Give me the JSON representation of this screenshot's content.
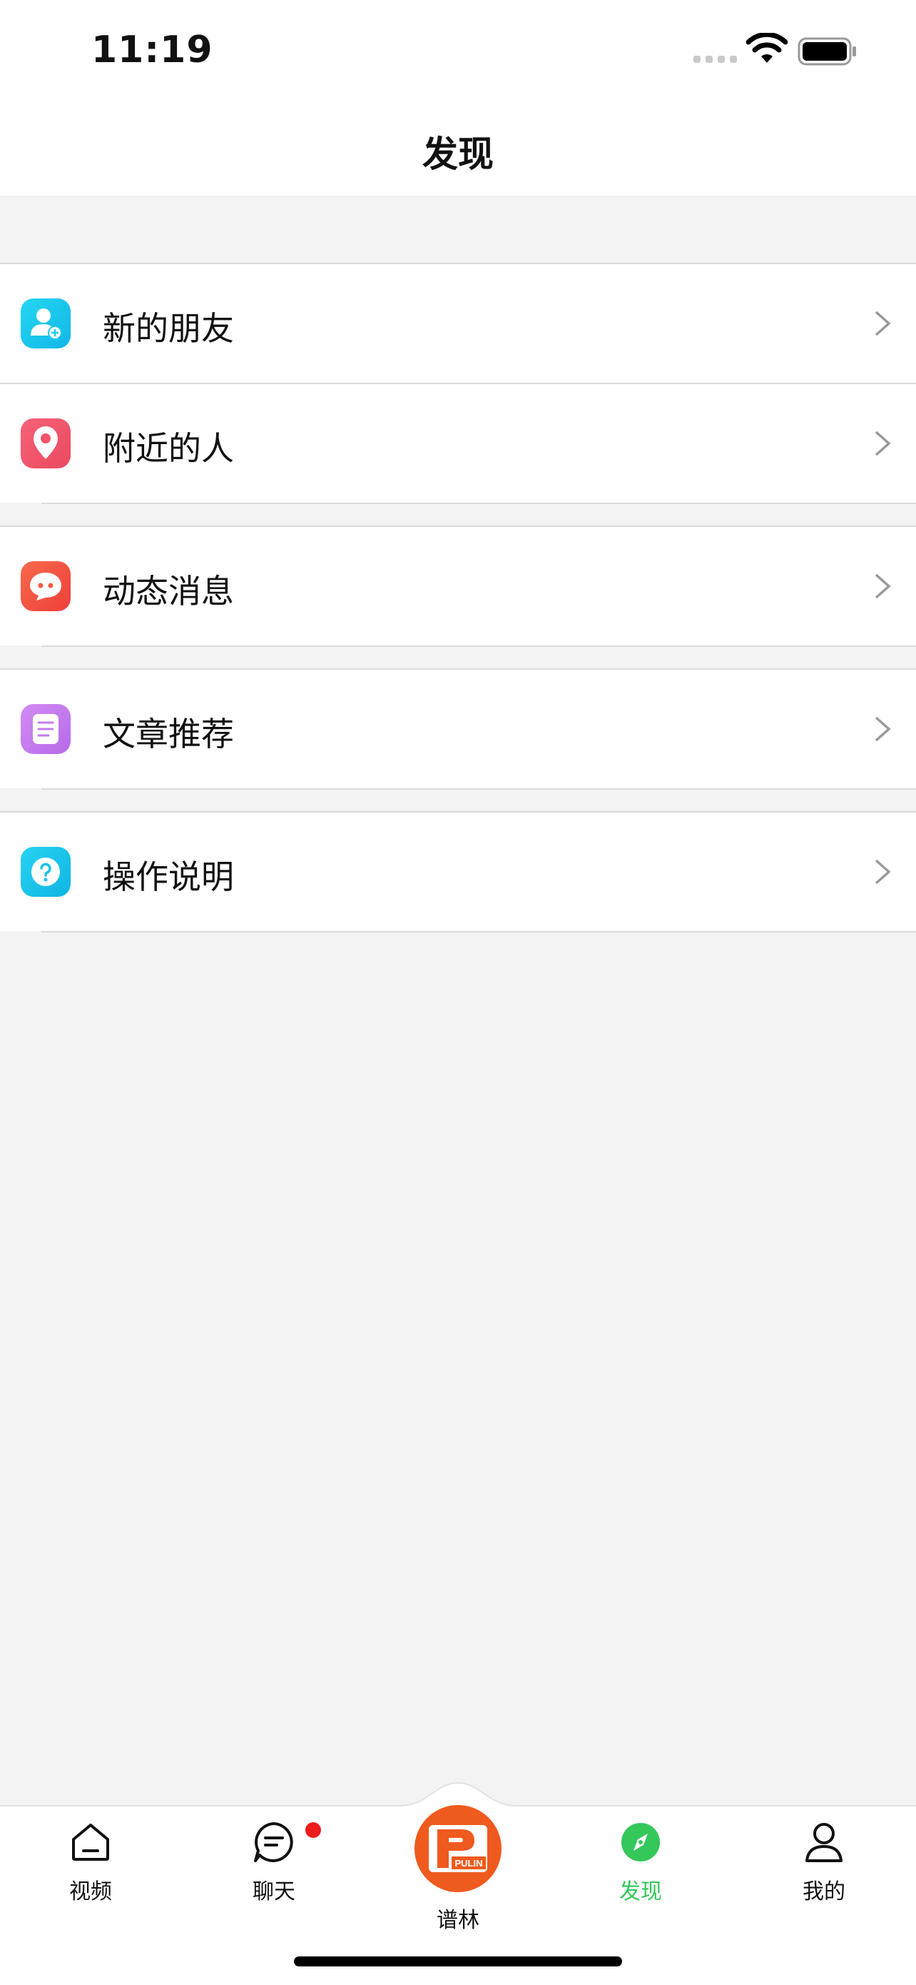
{
  "status_bar": {
    "time": "11:19"
  },
  "nav": {
    "title": "发现"
  },
  "menu": [
    {
      "label": "新的朋友",
      "icon": "add-friend-icon",
      "color": "#1ec9ec"
    },
    {
      "label": "附近的人",
      "icon": "location-pin-icon",
      "color": "#f2546b"
    },
    {
      "label": "动态消息",
      "icon": "chat-bubble-icon",
      "color": "#f45a43"
    },
    {
      "label": "文章推荐",
      "icon": "article-icon",
      "color": "#c57cf0"
    },
    {
      "label": "操作说明",
      "icon": "help-icon",
      "color": "#18c3ea"
    }
  ],
  "tabs": [
    {
      "label": "视频",
      "icon": "home-icon"
    },
    {
      "label": "聊天",
      "icon": "chat-icon",
      "badge": true
    },
    {
      "label": "谱林",
      "icon": "pulin-logo-icon",
      "logo_text": "PULIN"
    },
    {
      "label": "发现",
      "icon": "compass-icon",
      "active": true
    },
    {
      "label": "我的",
      "icon": "profile-icon"
    }
  ],
  "colors": {
    "accent": "#34c759",
    "brand": "#ef5a1e",
    "badge": "#ee1c1c"
  }
}
